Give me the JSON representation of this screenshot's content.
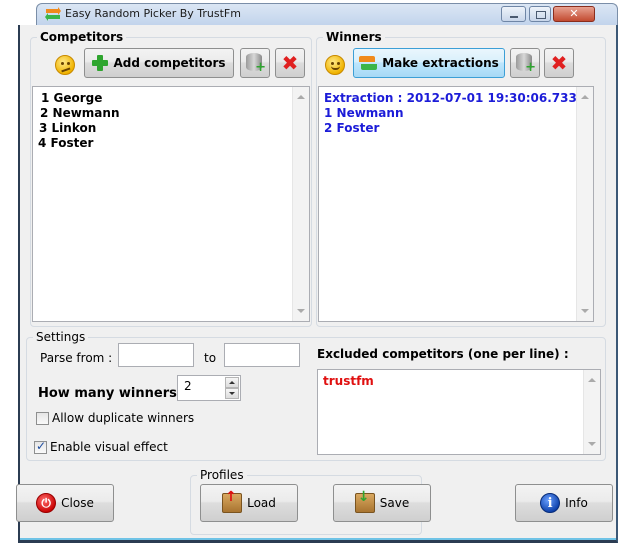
{
  "window": {
    "title": "Easy Random Picker By TrustFm",
    "controls": {
      "minimize": "minimize",
      "maximize": "maximize",
      "close": "✕"
    }
  },
  "competitors": {
    "group_label": "Competitors",
    "add_button_label": "Add competitors",
    "list": [
      "1 George",
      "2 Newmann",
      "3 Linkon",
      "4 Foster"
    ]
  },
  "winners": {
    "group_label": "Winners",
    "make_button_label": "Make extractions",
    "list": [
      "Extraction : 2012-07-01 19:30:06.733",
      "1 Newmann",
      "2 Foster"
    ],
    "text_color": "#1c1cd8"
  },
  "settings": {
    "group_label": "Settings",
    "parse_from_label": "Parse from :",
    "parse_from_value": "",
    "to_label": "to",
    "to_value": "",
    "how_many_label": "How many winners :",
    "how_many_value": "2",
    "allow_duplicates_label": "Allow duplicate winners",
    "allow_duplicates_checked": false,
    "visual_effect_label": "Enable visual effect",
    "visual_effect_checked": true
  },
  "excluded": {
    "label": "Excluded competitors (one per line) :",
    "list": [
      "trustfm"
    ],
    "text_color": "#e01010"
  },
  "profiles": {
    "group_label": "Profiles",
    "load_label": "Load",
    "save_label": "Save"
  },
  "footer": {
    "close_label": "Close",
    "info_label": "Info"
  }
}
